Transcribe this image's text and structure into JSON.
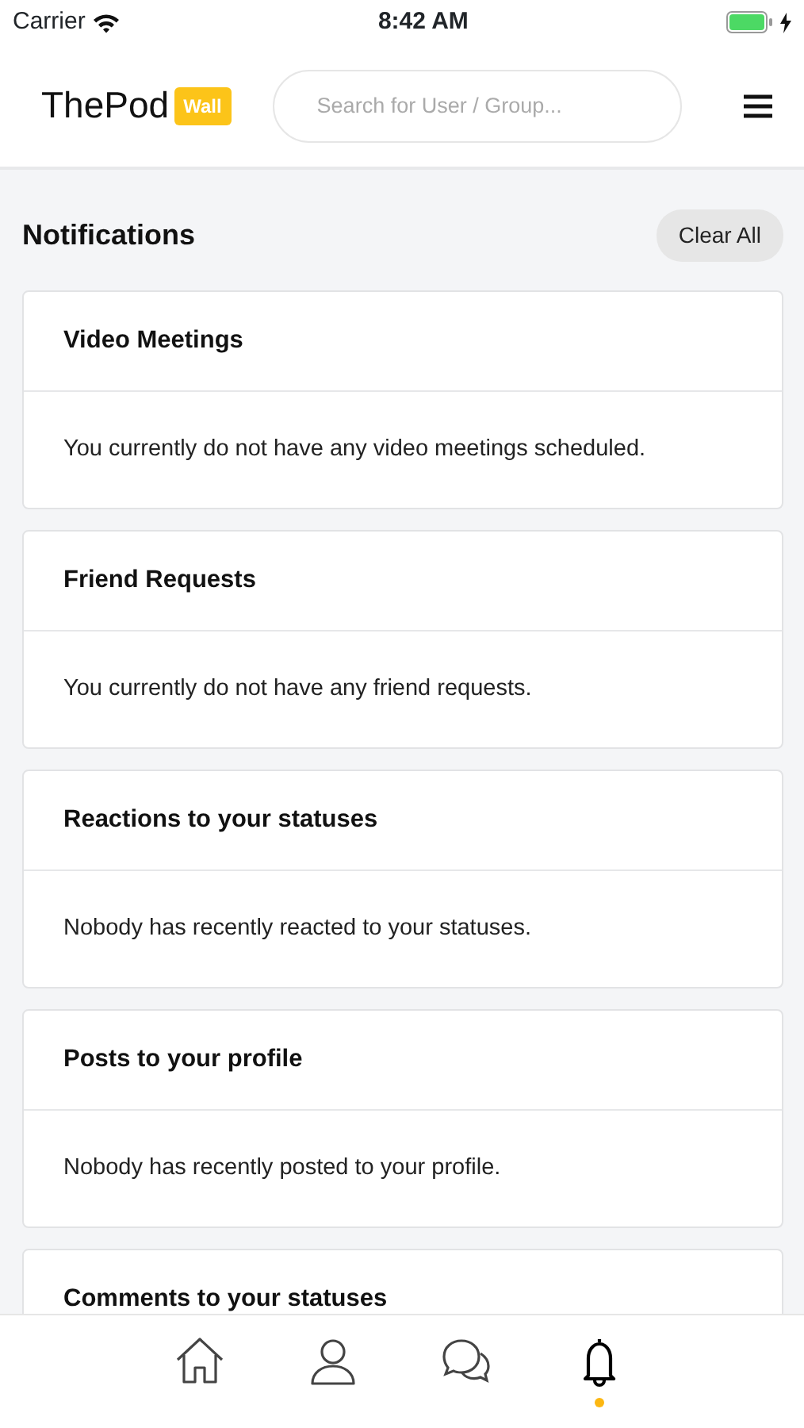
{
  "status_bar": {
    "carrier": "Carrier",
    "time": "8:42 AM",
    "battery": {
      "level": 1.0,
      "charging": true
    }
  },
  "header": {
    "logo": "ThePod",
    "logo_badge": "Wall",
    "search": {
      "placeholder": "Search for User / Group..."
    }
  },
  "page": {
    "title": "Notifications",
    "clear_button": "Clear All"
  },
  "sections": [
    {
      "title": "Video Meetings",
      "message": "You currently do not have any video meetings scheduled."
    },
    {
      "title": "Friend Requests",
      "message": "You currently do not have any friend requests."
    },
    {
      "title": "Reactions to your statuses",
      "message": "Nobody has recently reacted to your statuses."
    },
    {
      "title": "Posts to your profile",
      "message": "Nobody has recently posted to your profile."
    },
    {
      "title": "Comments to your statuses"
    }
  ],
  "tab_bar": [
    {
      "kind": "home",
      "selected": false
    },
    {
      "kind": "profile",
      "selected": false
    },
    {
      "kind": "chat",
      "selected": false
    },
    {
      "kind": "bell",
      "selected": true
    }
  ]
}
